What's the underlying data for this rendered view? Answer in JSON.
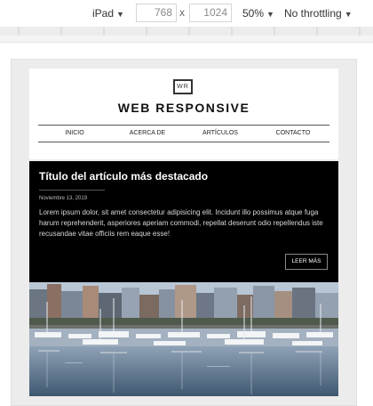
{
  "devtools": {
    "device": "iPad",
    "width": "768",
    "times": "x",
    "height": "1024",
    "zoom": "50%",
    "throttling": "No throttling"
  },
  "site": {
    "logo": "WR",
    "title": "WEB RESPONSIVE",
    "nav": [
      "INICIO",
      "ACERCA DE",
      "ARTÍCULOS",
      "CONTACTO"
    ]
  },
  "featured": {
    "title": "Título del artículo más destacado",
    "date": "Noviembre 13, 2019",
    "excerpt": "Lorem ipsum dolor, sit amet consectetur adipisicing elit. Incidunt illo possimus atque fuga harum reprehenderit, asperiores aperiam commodi, repellat deserunt odio repellendus iste recusandae vitae officiis rem eaque esse!",
    "button": "LEER MÁS"
  }
}
